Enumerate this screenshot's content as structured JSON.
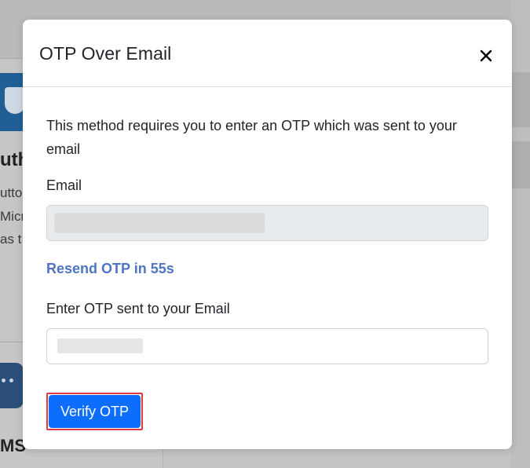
{
  "background": {
    "heading_fragment": "uth",
    "lines": [
      "utto",
      "Micr",
      "as t"
    ],
    "sms_fragment": "MS"
  },
  "modal": {
    "title": "OTP Over Email",
    "close_icon": "close-icon",
    "description": "This method requires you to enter an OTP which was sent to your email",
    "email_label": "Email",
    "email_value": "",
    "resend_text": "Resend OTP in 55s",
    "otp_label": "Enter OTP sent to your Email",
    "otp_value": "",
    "verify_label": "Verify OTP"
  },
  "colors": {
    "primary": "#0d6efd",
    "link": "#4f74c4",
    "highlight_border": "#e03a3e",
    "disabled_input_bg": "#e9ecef"
  }
}
